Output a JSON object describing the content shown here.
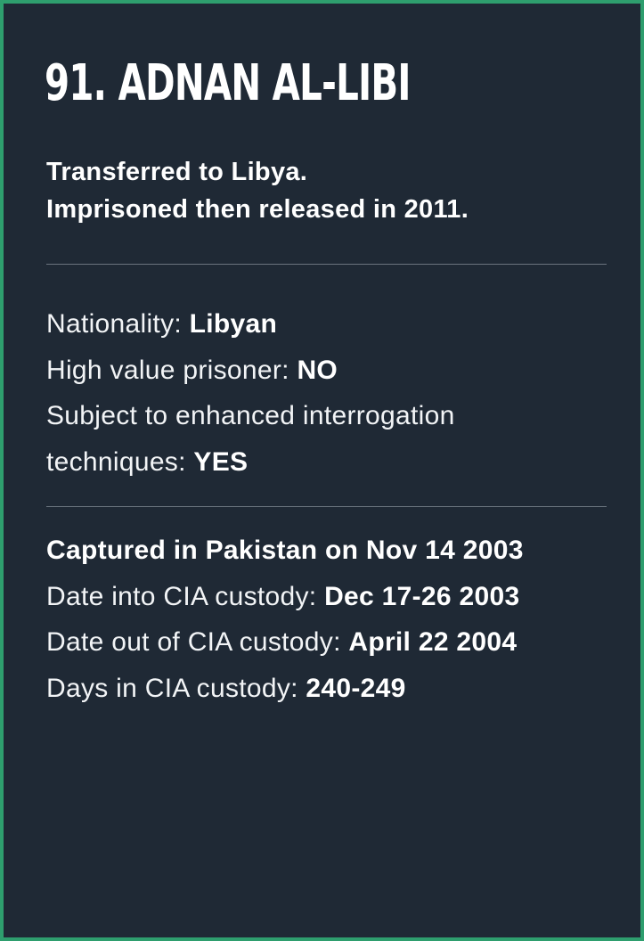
{
  "card": {
    "title": "91. ADNAN AL-LIBI",
    "summary": [
      "Transferred to Libya.",
      "Imprisoned then released in 2011."
    ],
    "details": {
      "nationality": {
        "label": "Nationality: ",
        "value": "Libyan"
      },
      "high_value": {
        "label": "High value prisoner: ",
        "value": "NO"
      },
      "enhanced_line1": "Subject to enhanced interrogation",
      "enhanced_line2": {
        "label": "techniques: ",
        "value": "YES"
      }
    },
    "custody": {
      "captured": "Captured in Pakistan on Nov 14 2003",
      "date_in": {
        "label": "Date into CIA custody: ",
        "value": "Dec 17-26 2003"
      },
      "date_out": {
        "label": "Date out of CIA custody: ",
        "value": "April 22 2004"
      },
      "days": {
        "label": "Days in CIA custody: ",
        "value": "240-249"
      }
    }
  }
}
